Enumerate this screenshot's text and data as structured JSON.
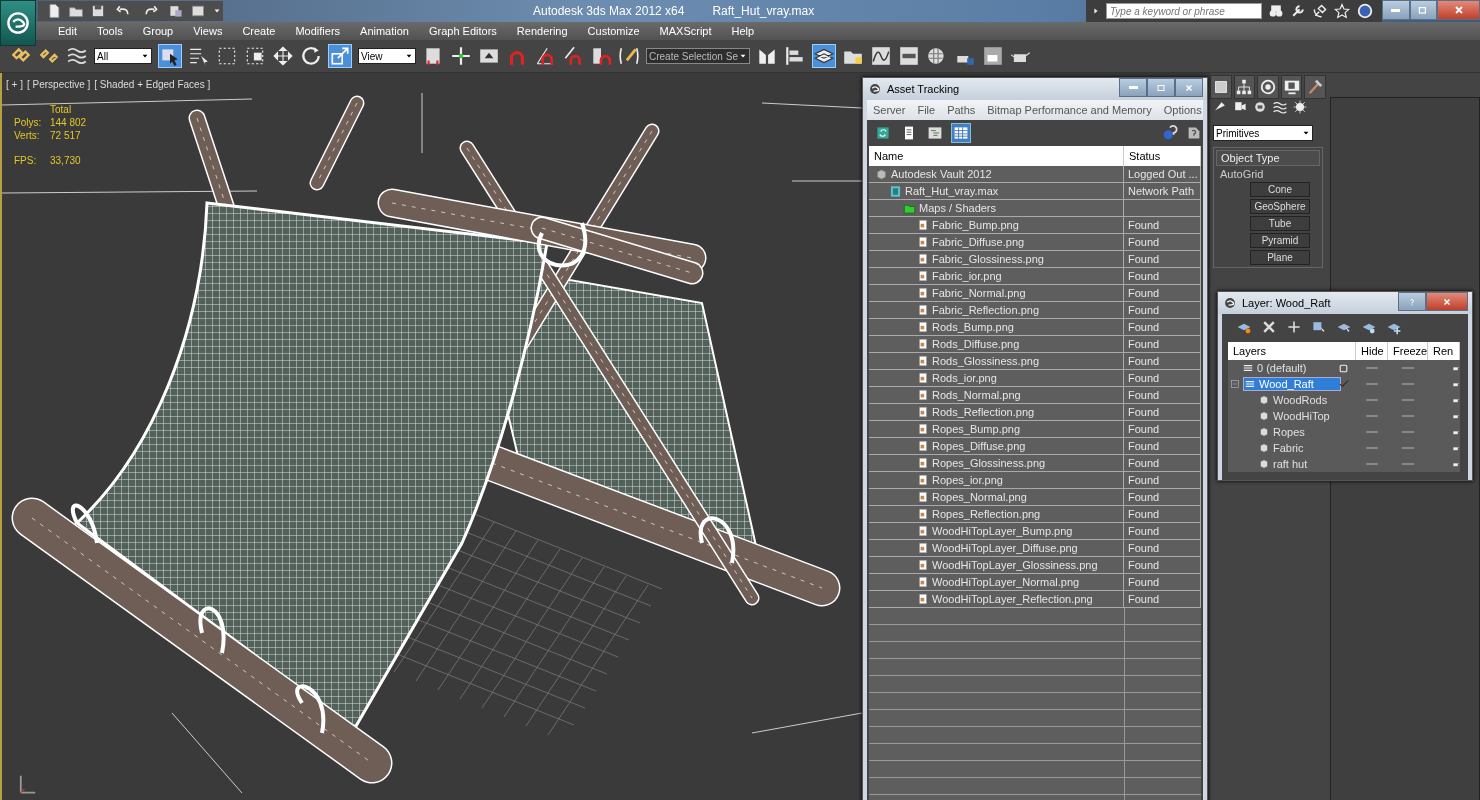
{
  "title_bar": {
    "app_title": "Autodesk 3ds Max  2012 x64",
    "file_name": "Raft_Hut_vray.max",
    "search": {
      "placeholder": "Type a keyword or phrase"
    }
  },
  "menu": [
    "Edit",
    "Tools",
    "Group",
    "Views",
    "Create",
    "Modifiers",
    "Animation",
    "Graph Editors",
    "Rendering",
    "Customize",
    "MAXScript",
    "Help"
  ],
  "toolbar": {
    "selection_filter": "All",
    "reference_coord": "View",
    "named_selection": "Create Selection Se"
  },
  "viewport": {
    "labels": [
      "[ + ]",
      "[ Perspective ]",
      "[ Shaded + Edged Faces ]"
    ],
    "stats_header": "Total",
    "stats": [
      {
        "label": "Polys:",
        "value": "144 802"
      },
      {
        "label": "Verts:",
        "value": "72 517"
      }
    ],
    "fps": {
      "label": "FPS:",
      "value": "33,730"
    }
  },
  "asset_tracking": {
    "title": "Asset Tracking",
    "menu": [
      "Server",
      "File",
      "Paths",
      "Bitmap Performance and Memory",
      "Options"
    ],
    "view_buttons": [
      {
        "selected": false
      },
      {
        "selected": false
      },
      {
        "selected": false
      },
      {
        "selected": true
      }
    ],
    "columns": [
      "Name",
      "Status"
    ],
    "tree": [
      {
        "name": "Autodesk Vault 2012",
        "kind": "vault",
        "status": "Logged Out ...",
        "children": [
          {
            "name": "Raft_Hut_vray.max",
            "kind": "scene",
            "status": "Network Path",
            "children": [
              {
                "name": "Maps / Shaders",
                "kind": "folder",
                "children": [
                  {
                    "name": "Fabric_Bump.png",
                    "kind": "file",
                    "status": "Found"
                  },
                  {
                    "name": "Fabric_Diffuse.png",
                    "kind": "file",
                    "status": "Found"
                  },
                  {
                    "name": "Fabric_Glossiness.png",
                    "kind": "file",
                    "status": "Found"
                  },
                  {
                    "name": "Fabric_ior.png",
                    "kind": "file",
                    "status": "Found"
                  },
                  {
                    "name": "Fabric_Normal.png",
                    "kind": "file",
                    "status": "Found"
                  },
                  {
                    "name": "Fabric_Reflection.png",
                    "kind": "file",
                    "status": "Found"
                  },
                  {
                    "name": "Rods_Bump.png",
                    "kind": "file",
                    "status": "Found"
                  },
                  {
                    "name": "Rods_Diffuse.png",
                    "kind": "file",
                    "status": "Found"
                  },
                  {
                    "name": "Rods_Glossiness.png",
                    "kind": "file",
                    "status": "Found"
                  },
                  {
                    "name": "Rods_ior.png",
                    "kind": "file",
                    "status": "Found"
                  },
                  {
                    "name": "Rods_Normal.png",
                    "kind": "file",
                    "status": "Found"
                  },
                  {
                    "name": "Rods_Reflection.png",
                    "kind": "file",
                    "status": "Found"
                  },
                  {
                    "name": "Ropes_Bump.png",
                    "kind": "file",
                    "status": "Found"
                  },
                  {
                    "name": "Ropes_Diffuse.png",
                    "kind": "file",
                    "status": "Found"
                  },
                  {
                    "name": "Ropes_Glossiness.png",
                    "kind": "file",
                    "status": "Found"
                  },
                  {
                    "name": "Ropes_ior.png",
                    "kind": "file",
                    "status": "Found"
                  },
                  {
                    "name": "Ropes_Normal.png",
                    "kind": "file",
                    "status": "Found"
                  },
                  {
                    "name": "Ropes_Reflection.png",
                    "kind": "file",
                    "status": "Found"
                  },
                  {
                    "name": "WoodHiTopLayer_Bump.png",
                    "kind": "file",
                    "status": "Found"
                  },
                  {
                    "name": "WoodHiTopLayer_Diffuse.png",
                    "kind": "file",
                    "status": "Found"
                  },
                  {
                    "name": "WoodHiTopLayer_Glossiness.png",
                    "kind": "file",
                    "status": "Found"
                  },
                  {
                    "name": "WoodHiTopLayer_Normal.png",
                    "kind": "file",
                    "status": "Found"
                  },
                  {
                    "name": "WoodHiTopLayer_Reflection.png",
                    "kind": "file",
                    "status": "Found"
                  }
                ]
              }
            ]
          }
        ]
      }
    ]
  },
  "command_panel": {
    "category": "Primitives",
    "rollout": "Object Type",
    "autogrid": "AutoGrid",
    "buttons": [
      "Cone",
      "GeoSphere",
      "Tube",
      "Pyramid",
      "Plane"
    ]
  },
  "layer_window": {
    "title": "Layer: Wood_Raft",
    "columns": [
      "Layers",
      "Hide",
      "Freeze",
      "Ren"
    ],
    "layers": [
      {
        "name": "0 (default)",
        "kind": "layer",
        "current": false,
        "selected": false
      },
      {
        "name": "Wood_Raft",
        "kind": "layer",
        "current": true,
        "selected": true,
        "expanded": true,
        "children": [
          {
            "name": "WoodRods",
            "kind": "object",
            "selected": false
          },
          {
            "name": "WoodHiTop",
            "kind": "object",
            "selected": false
          },
          {
            "name": "Ropes",
            "kind": "object",
            "selected": false
          },
          {
            "name": "Fabric",
            "kind": "object",
            "selected": false
          },
          {
            "name": "raft hut",
            "kind": "object",
            "selected": false
          }
        ]
      }
    ]
  }
}
